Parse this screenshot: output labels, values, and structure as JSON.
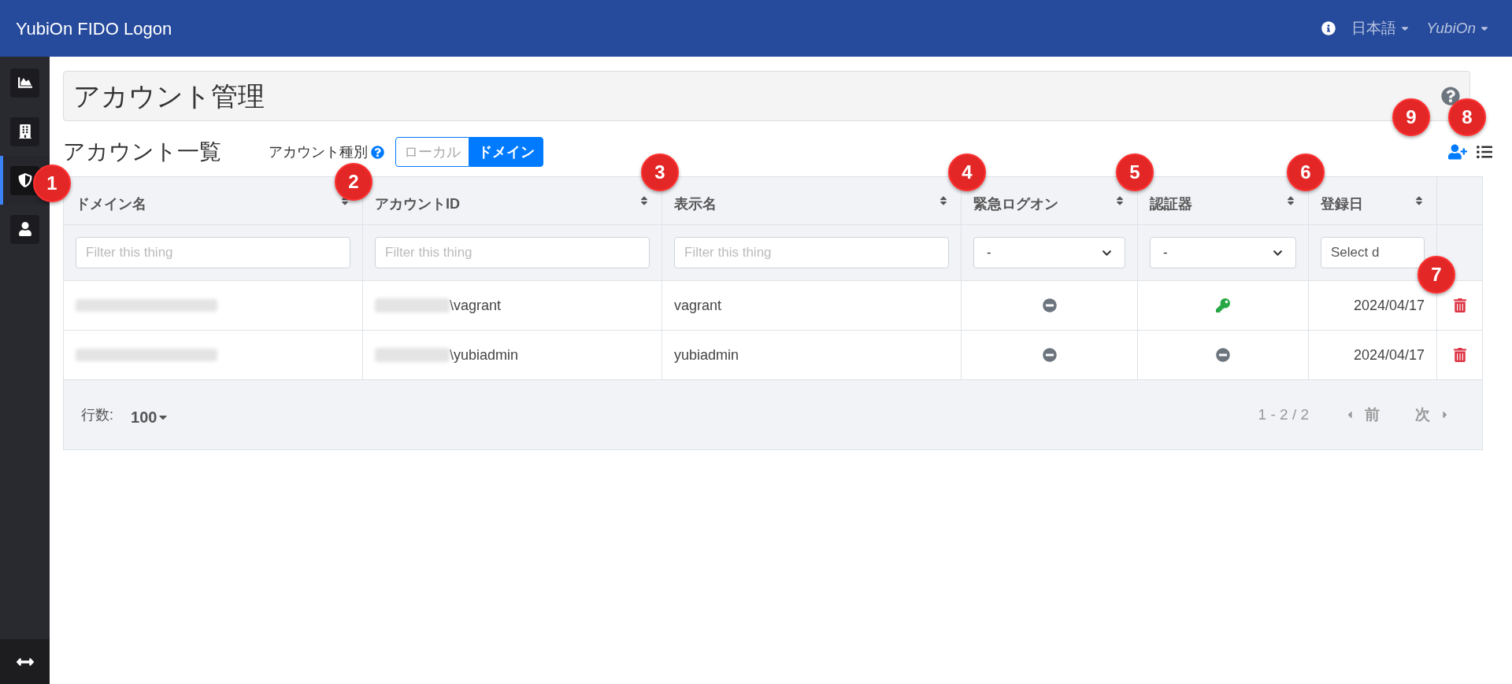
{
  "navbar": {
    "brand": "YubiOn FIDO Logon",
    "language": "日本語",
    "user": "YubiOn"
  },
  "sidebar": {
    "items": [
      {
        "selected": false
      },
      {
        "selected": false
      },
      {
        "selected": true
      },
      {
        "selected": false
      }
    ]
  },
  "page_title": "アカウント管理",
  "section": {
    "title": "アカウント一覧",
    "account_type_label": "アカウント種別",
    "account_types": [
      {
        "label": "ローカル",
        "selected": false
      },
      {
        "label": "ドメイン",
        "selected": true
      }
    ]
  },
  "table": {
    "columns": [
      {
        "label": "ドメイン名",
        "filter": {
          "kind": "text",
          "placeholder": "Filter this thing"
        }
      },
      {
        "label": "アカウントID",
        "filter": {
          "kind": "text",
          "placeholder": "Filter this thing"
        }
      },
      {
        "label": "表示名",
        "filter": {
          "kind": "text",
          "placeholder": "Filter this thing"
        }
      },
      {
        "label": "緊急ログオン",
        "filter": {
          "kind": "select",
          "value": "-"
        }
      },
      {
        "label": "認証器",
        "filter": {
          "kind": "select",
          "value": "-"
        }
      },
      {
        "label": "登録日",
        "filter": {
          "kind": "date",
          "placeholder": "Select d"
        }
      }
    ],
    "rows": [
      {
        "domain_blurred": true,
        "account_id_prefix_blurred": true,
        "account_id": "\\vagrant",
        "display_name": "vagrant",
        "emergency_logon": false,
        "authenticator_registered": true,
        "date": "2024/04/17"
      },
      {
        "domain_blurred": true,
        "account_id_prefix_blurred": true,
        "account_id": "\\yubiadmin",
        "display_name": "yubiadmin",
        "emergency_logon": false,
        "authenticator_registered": false,
        "date": "2024/04/17"
      }
    ]
  },
  "footer": {
    "rows_label": "行数:",
    "rows_value": "100",
    "range": "1 - 2 / 2",
    "prev": "前",
    "next": "次"
  },
  "callouts": [
    "1",
    "2",
    "3",
    "4",
    "5",
    "6",
    "7",
    "8",
    "9"
  ]
}
